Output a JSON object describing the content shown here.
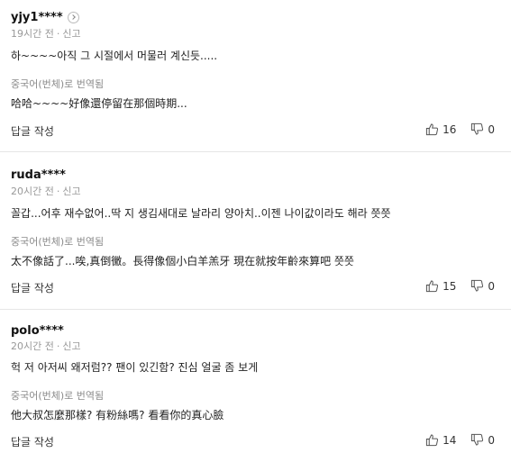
{
  "comments": [
    {
      "author": "yjy1****",
      "time": "19시간 전",
      "report": "신고",
      "text": "하~~~~아직 그 시절에서 머물러 계신듯.....",
      "translate_label": "중국어(번체)로 번역됨",
      "translated": "哈哈~~~~好像還停留在那個時期...",
      "reply": "답글 작성",
      "likes": "16",
      "dislikes": "0"
    },
    {
      "author": "ruda****",
      "time": "20시간 전",
      "report": "신고",
      "text": "꼴갑...어후 재수없어..딱 지 생김새대로 날라리 양아치..이젠 나이값이라도 해라 쯧쯧",
      "translate_label": "중국어(번체)로 번역됨",
      "translated": "太不像話了...唉,真倒黴。長得像個小白羊羔牙 現在就按年齡來算吧 쯧쯧",
      "reply": "답글 작성",
      "likes": "15",
      "dislikes": "0"
    },
    {
      "author": "polo****",
      "time": "20시간 전",
      "report": "신고",
      "text": "헉 저 아저씨 왜저럼?? 팬이 있긴함? 진심 얼굴 좀 보게",
      "translate_label": "중국어(번체)로 번역됨",
      "translated": "他大叔怎麼那樣? 有粉絲嗎? 看看你的真心臉",
      "reply": "답글 작성",
      "likes": "14",
      "dislikes": "0"
    }
  ]
}
